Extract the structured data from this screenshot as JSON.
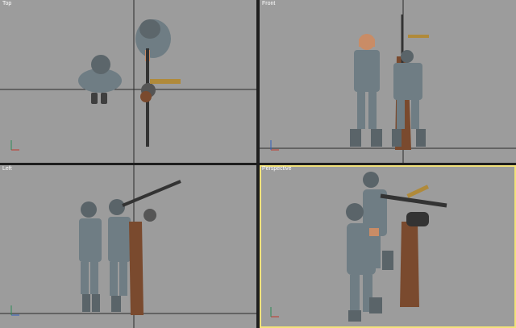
{
  "viewports": {
    "top": {
      "label": "Top"
    },
    "front": {
      "label": "Front"
    },
    "left": {
      "label": "Left"
    },
    "perspective": {
      "label": "Perspective"
    }
  },
  "colors": {
    "viewport_bg": "#9c9c9c",
    "divider": "#1e1e1e",
    "active_border": "#f2e27a",
    "grid_line": "#2a2a2a",
    "uniform": "#6f7d84",
    "skin": "#c98c66",
    "wood": "#7a4a2e",
    "gun": "#333333",
    "strap": "#b08a3a"
  }
}
